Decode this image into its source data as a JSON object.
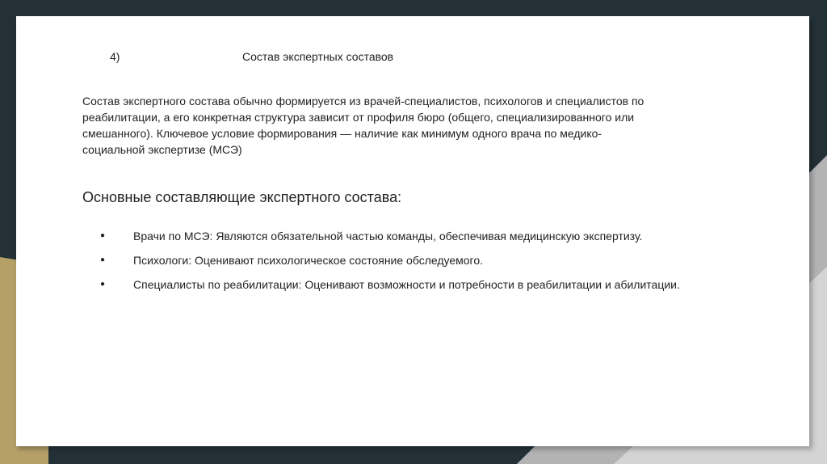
{
  "slide": {
    "number": "4)",
    "title": "Состав экспертных составов",
    "paragraph_lines": [
      "Состав экспертного состава обычно формируется из врачей-специалистов, психологов и специалистов по",
      "реабилитации, а его конкретная структура зависит от профиля бюро (общего, специализированного или",
      "смешанного). Ключевое условие формирования — наличие как минимум одного врача по медико-",
      "социальной экспертизе (МСЭ)"
    ],
    "section_heading": "Основные составляющие экспертного состава:",
    "bullet_symbol": "●",
    "bullets": [
      "Врачи по МСЭ: Являются обязательной частью команды, обеспечивая медицинскую экспертизу.",
      "Психологи: Оценивают психологическое состояние обследуемого.",
      "Специалисты по реабилитации: Оценивают возможности и потребности в реабилитации и абилитации."
    ]
  },
  "colors": {
    "background_dark": "#233137",
    "accent_gold": "#b5a068",
    "accent_grey": "#b3b3b3",
    "slide_background": "#ffffff",
    "text": "#222222"
  }
}
